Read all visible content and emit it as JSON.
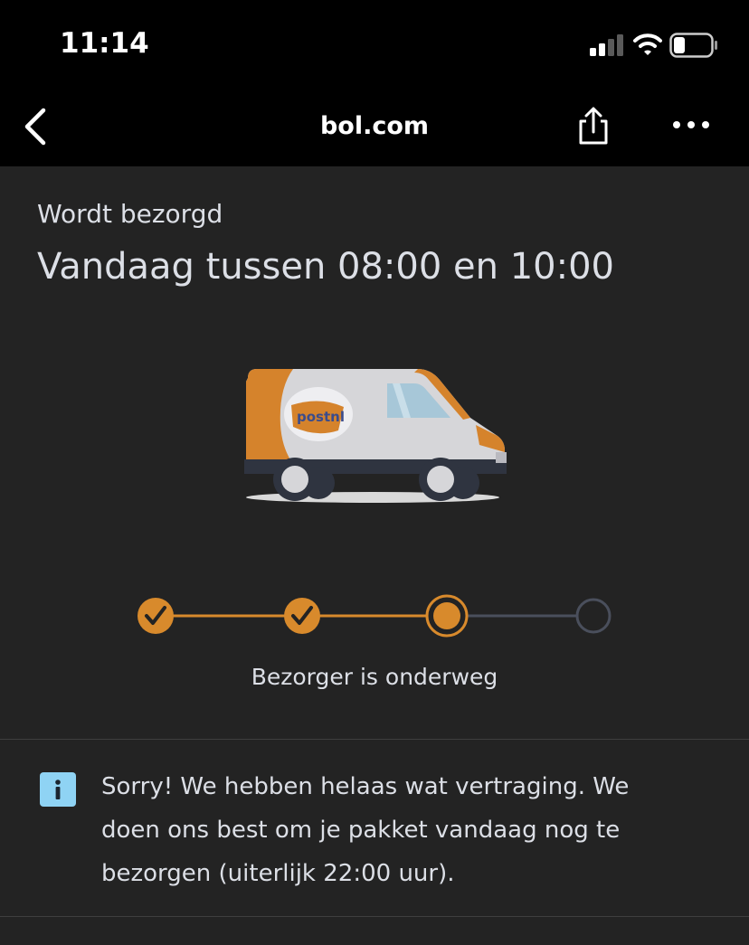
{
  "status_bar": {
    "time": "11:14",
    "signal_icon": "cellular-signal-icon",
    "wifi_icon": "wifi-icon",
    "battery_icon": "battery-icon"
  },
  "nav": {
    "back_icon": "chevron-left-icon",
    "title": "bol.com",
    "share_icon": "share-icon",
    "more_icon": "more-icon"
  },
  "delivery": {
    "status_label": "Wordt bezorgd",
    "window": "Vandaag tussen 08:00 en 10:00",
    "carrier_logo_text": "postnl",
    "progress": {
      "steps_total": 4,
      "completed_steps": 2,
      "current_step": 3,
      "caption": "Bezorger is onderweg"
    }
  },
  "notice": {
    "icon": "info-icon",
    "message": "Sorry! We hebben helaas wat vertraging. We doen ons best om je pakket vandaag nog te bezorgen (uiterlijk 22:00 uur)."
  },
  "colors": {
    "accent": "#d88a2c",
    "background": "#232323",
    "inactive_step": "#4a4f5c",
    "info_icon_bg": "#8fd3f4",
    "text": "#dcdfe6"
  }
}
